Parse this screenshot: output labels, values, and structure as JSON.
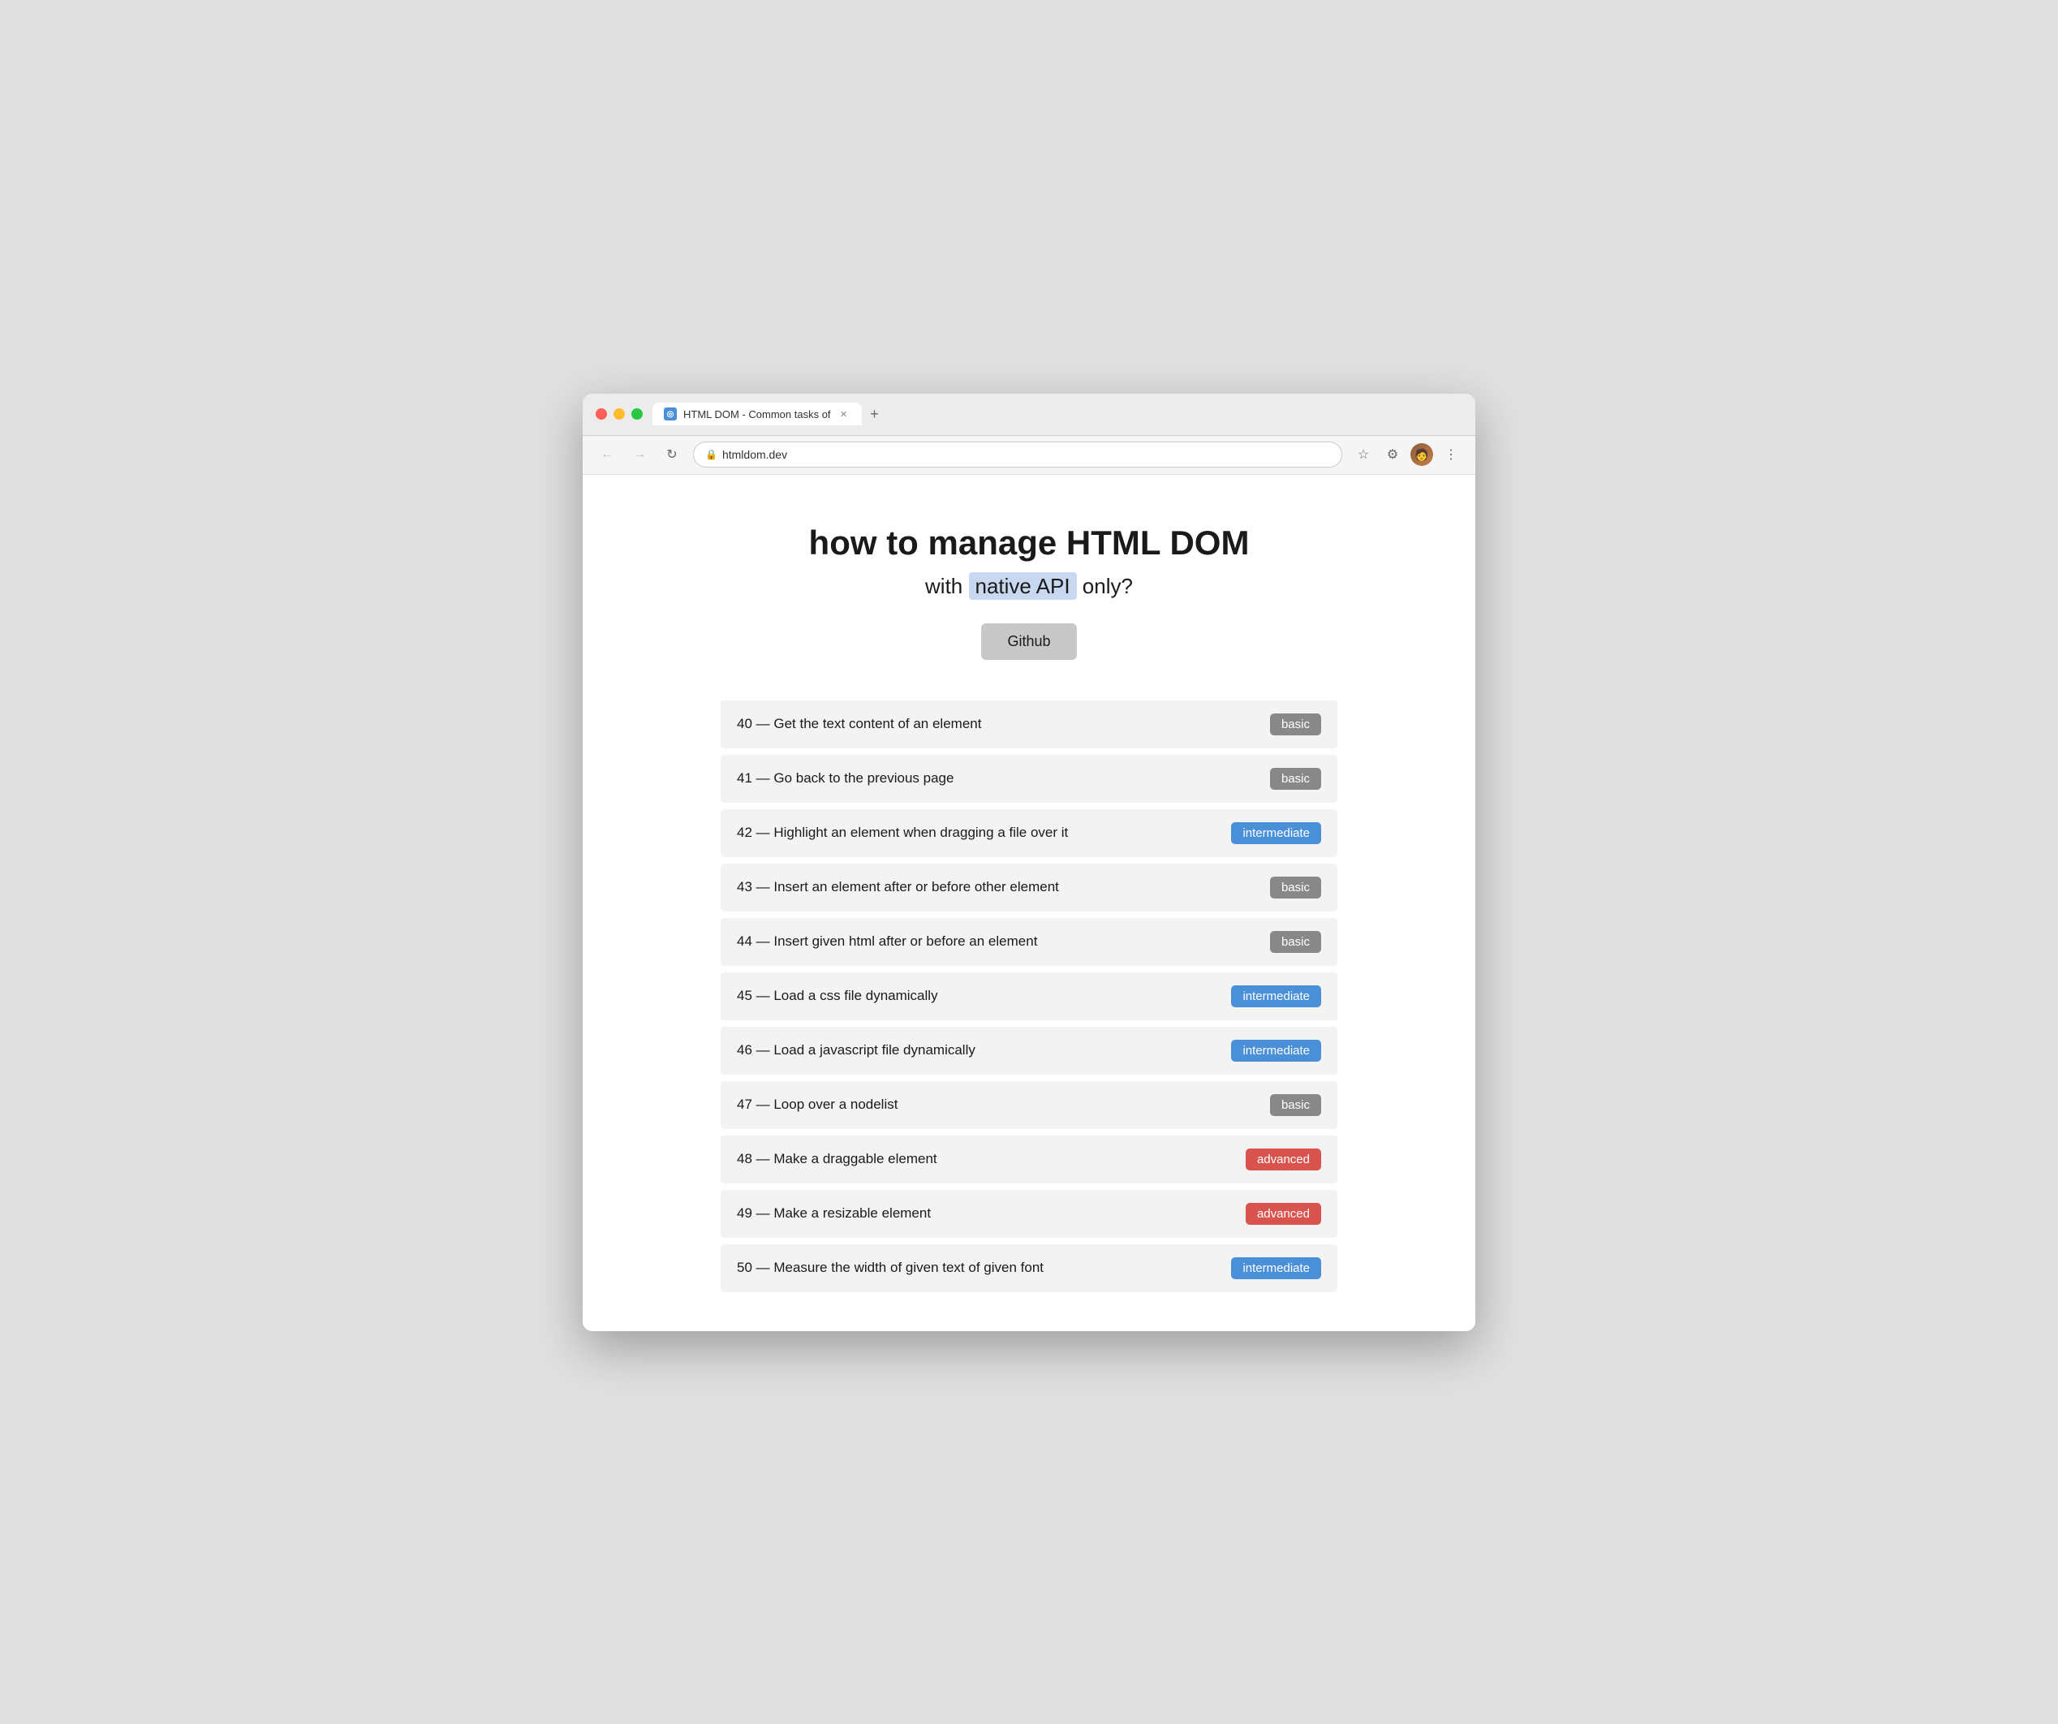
{
  "browser": {
    "tab_title": "HTML DOM - Common tasks of",
    "url": "htmldom.dev",
    "back_btn": "←",
    "forward_btn": "→",
    "refresh_btn": "↻",
    "new_tab_btn": "+",
    "favicon_text": "◎"
  },
  "page": {
    "title": "how to manage HTML DOM",
    "subtitle_before": "with ",
    "subtitle_highlight": "native API",
    "subtitle_after": " only?",
    "github_label": "Github"
  },
  "tasks": [
    {
      "id": 40,
      "label": "40 — Get the text content of an element",
      "level": "basic"
    },
    {
      "id": 41,
      "label": "41 — Go back to the previous page",
      "level": "basic"
    },
    {
      "id": 42,
      "label": "42 — Highlight an element when dragging a file over it",
      "level": "intermediate"
    },
    {
      "id": 43,
      "label": "43 — Insert an element after or before other element",
      "level": "basic"
    },
    {
      "id": 44,
      "label": "44 — Insert given html after or before an element",
      "level": "basic"
    },
    {
      "id": 45,
      "label": "45 — Load a css file dynamically",
      "level": "intermediate"
    },
    {
      "id": 46,
      "label": "46 — Load a javascript file dynamically",
      "level": "intermediate"
    },
    {
      "id": 47,
      "label": "47 — Loop over a nodelist",
      "level": "basic"
    },
    {
      "id": 48,
      "label": "48 — Make a draggable element",
      "level": "advanced"
    },
    {
      "id": 49,
      "label": "49 — Make a resizable element",
      "level": "advanced"
    },
    {
      "id": 50,
      "label": "50 — Measure the width of given text of given font",
      "level": "intermediate"
    }
  ],
  "badge_labels": {
    "basic": "basic",
    "intermediate": "intermediate",
    "advanced": "advanced"
  },
  "colors": {
    "basic": "#888888",
    "intermediate": "#4a90d9",
    "advanced": "#d9534f"
  }
}
